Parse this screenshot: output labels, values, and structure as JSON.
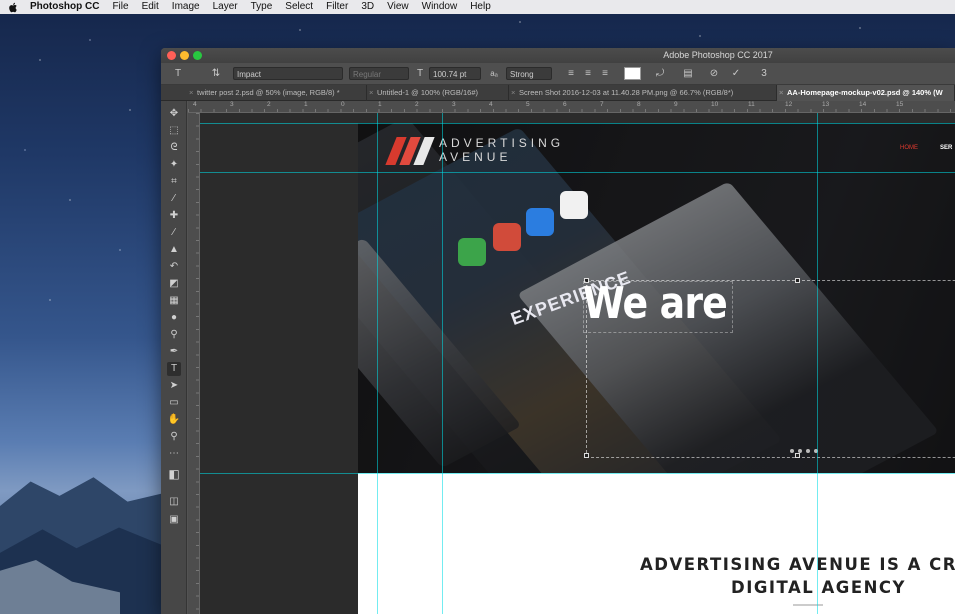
{
  "menubar": {
    "app": "Photoshop CC",
    "items": [
      "File",
      "Edit",
      "Image",
      "Layer",
      "Type",
      "Select",
      "Filter",
      "3D",
      "View",
      "Window",
      "Help"
    ]
  },
  "window": {
    "title": "Adobe Photoshop CC 2017"
  },
  "options_bar": {
    "font_family": "Impact",
    "font_style": "Regular",
    "font_size": "100.74 pt",
    "anti_alias": "Strong",
    "text_color": "#ffffff",
    "aa_icon": "aa-icon"
  },
  "tabs": [
    {
      "label": "twitter post 2.psd @ 50% (image, RGB/8) *"
    },
    {
      "label": "Untitled-1 @ 100% (RGB/16#)"
    },
    {
      "label": "Screen Shot 2016-12-03 at 11.40.28 PM.png @ 66.7% (RGB/8*)"
    },
    {
      "label": "AA-Homepage-mockup-v02.psd @ 140% (W"
    }
  ],
  "ruler": {
    "numbers": [
      "4",
      "3",
      "2",
      "1",
      "0",
      "1",
      "2",
      "3",
      "4",
      "5",
      "6",
      "7",
      "8",
      "9",
      "10",
      "11",
      "12",
      "13",
      "14",
      "15"
    ]
  },
  "document": {
    "logo_line1": "ADVERTISING",
    "logo_line2": "AVENUE",
    "nav_home": "HOME",
    "nav_services": "SER",
    "headline": "We are",
    "about_line1": "ADVERTISING AVENUE IS A CREATIV",
    "about_line2": "DIGITAL AGENCY",
    "mockup_text": "EXPERIENCE"
  },
  "colors": {
    "accent_red": "#e03a2f",
    "guide": "#00dce6"
  }
}
